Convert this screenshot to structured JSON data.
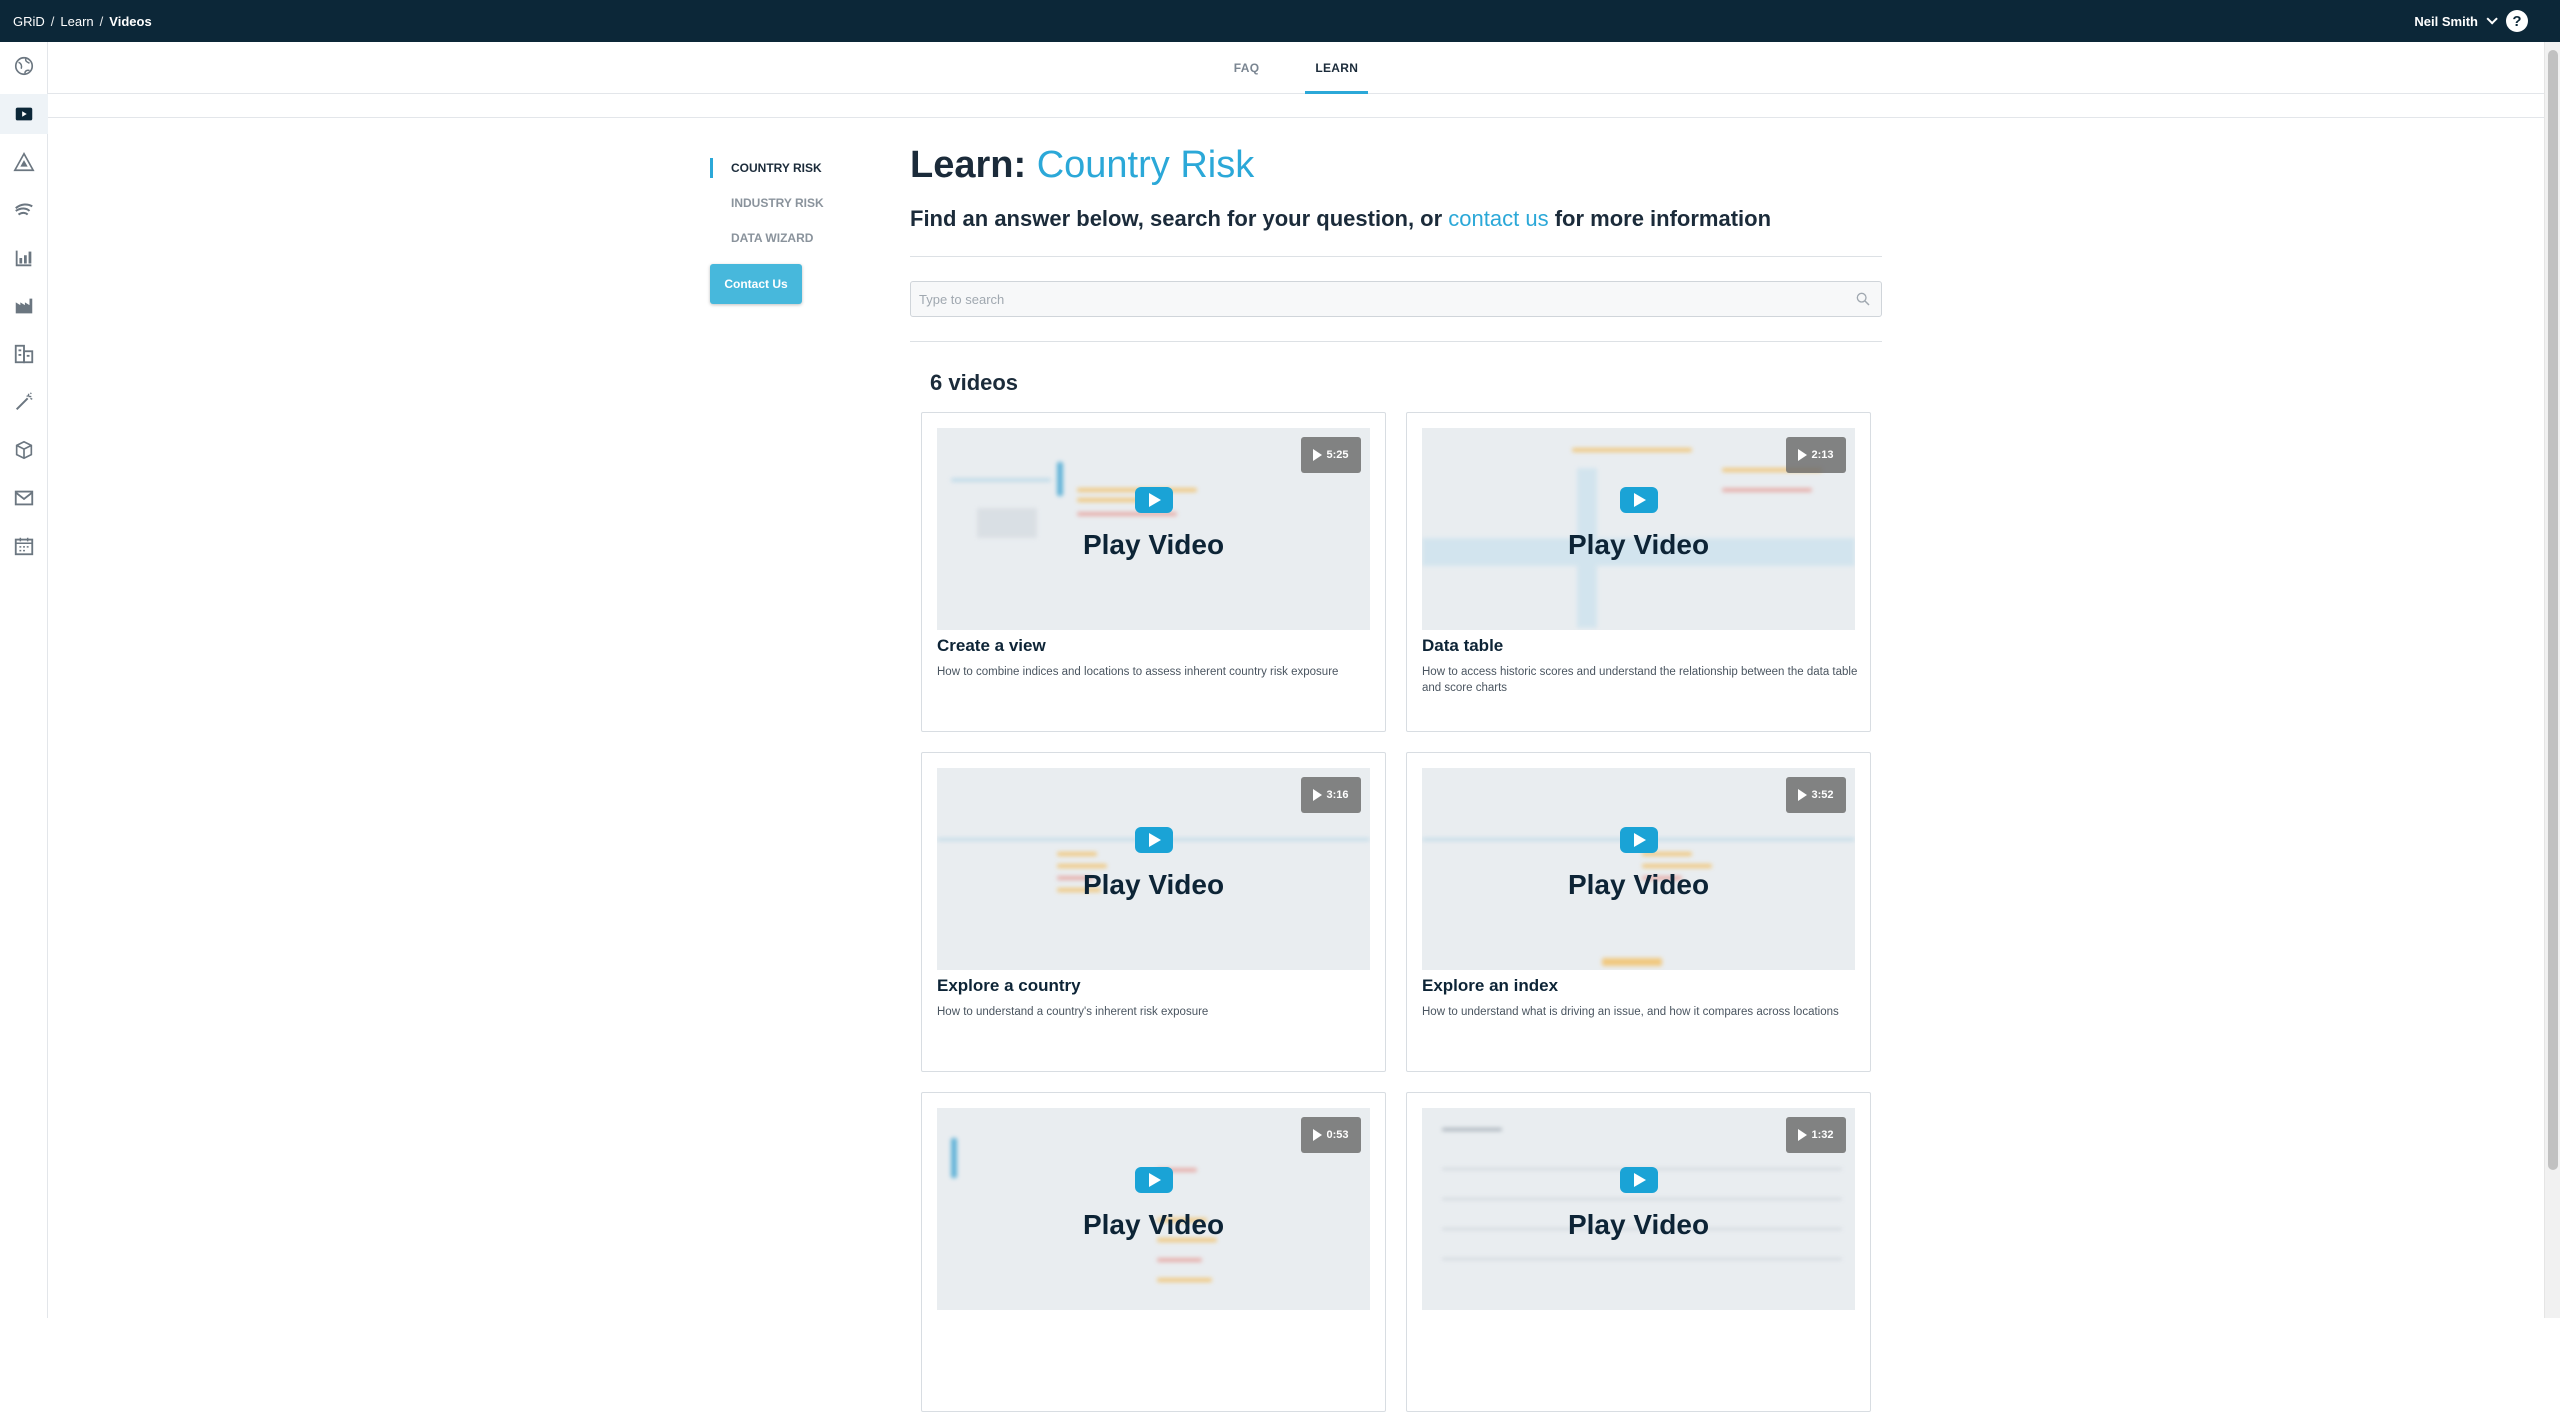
{
  "breadcrumbs": [
    "GRiD",
    "Learn",
    "Videos"
  ],
  "user": {
    "name": "Neil Smith",
    "help": "?"
  },
  "rail": [
    "globe-icon",
    "video-icon",
    "warning-triangle-icon",
    "risk-fan-icon",
    "chart-building-icon",
    "factory-icon",
    "buildings-icon",
    "wand-icon",
    "boxes-icon",
    "mail-icon",
    "calendar-icon"
  ],
  "tabs": [
    {
      "label": "FAQ",
      "active": false
    },
    {
      "label": "LEARN",
      "active": true
    }
  ],
  "sidenav": {
    "items": [
      {
        "label": "COUNTRY RISK",
        "active": true
      },
      {
        "label": "INDUSTRY RISK",
        "active": false
      },
      {
        "label": "DATA WIZARD",
        "active": false
      }
    ],
    "contact_button": "Contact Us"
  },
  "main": {
    "heading_prefix": "Learn:",
    "heading_highlight": "Country Risk",
    "sub_before": "Find an answer below, search for your question, or",
    "sub_link": "contact us",
    "sub_after": "for more information",
    "search_placeholder": "Type to search",
    "count_label": "6 videos"
  },
  "videos": [
    {
      "title": "Create a view",
      "description": "How to combine indices and locations to assess inherent country risk exposure",
      "duration": "5:25",
      "play_label": "Play Video"
    },
    {
      "title": "Data table",
      "description": "How to access historic scores and understand the relationship between the data table and score charts",
      "duration": "2:13",
      "play_label": "Play Video"
    },
    {
      "title": "Explore a country",
      "description": "How to understand a country's inherent risk exposure",
      "duration": "3:16",
      "play_label": "Play Video"
    },
    {
      "title": "Explore an index",
      "description": "How to understand what is driving an issue, and how it compares across locations",
      "duration": "3:52",
      "play_label": "Play Video"
    },
    {
      "title": "",
      "description": "",
      "duration": "0:53",
      "play_label": "Play Video"
    },
    {
      "title": "",
      "description": "",
      "duration": "1:32",
      "play_label": "Play Video"
    }
  ],
  "colors": {
    "topbar": "#0c2738",
    "accent": "#2ba8d8",
    "button": "#47b8dc",
    "play": "#1aa3d6"
  }
}
